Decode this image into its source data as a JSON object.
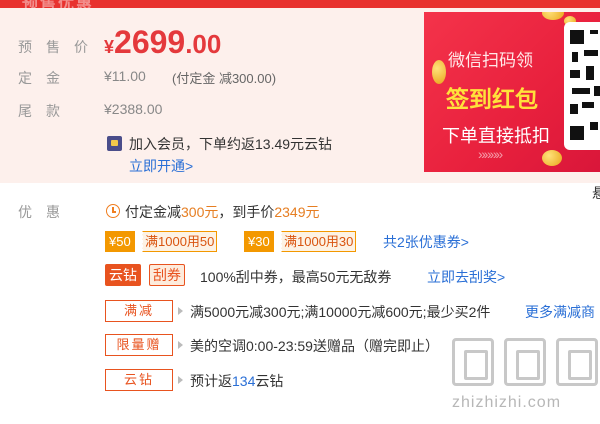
{
  "header_ghost_text": "预售优惠",
  "price": {
    "label": "预售价",
    "currency": "¥",
    "integer": "2699",
    "decimal": ".00",
    "color": "#e4393c"
  },
  "deposit": {
    "label": "定金",
    "value": "¥11.00",
    "note": "(付定金 减300.00)"
  },
  "final_payment": {
    "label": "尾款",
    "value": "¥2388.00"
  },
  "member": {
    "icon": "crown-icon",
    "text": "加入会员，下单约返13.49元云钻",
    "link": "立即开通>"
  },
  "promo_banner": {
    "line1": "微信扫码领",
    "line2": "签到红包",
    "line3": "下单直接抵扣",
    "arrows": "»»»»",
    "icon": "qr-code-icon"
  },
  "edge_char": "悬",
  "promotions": {
    "label": "优惠",
    "deposit_offer": {
      "icon": "clock-icon",
      "p1": "付定金减",
      "amount": "300元",
      "p2": "，到手价",
      "final": "2349元"
    },
    "coupons": [
      {
        "value": "¥50",
        "condition": "满1000用50"
      },
      {
        "value": "¥30",
        "condition": "满1000用30"
      }
    ],
    "coupon_link": "共2张优惠券>",
    "scratch": {
      "tag_a": "云钻",
      "tag_b": "刮券",
      "text": "100%刮中券，最高50元无敌券",
      "link": "立即去刮奖>"
    },
    "full_reduction": {
      "tag": "满减",
      "text": "满5000元减300元;满10000元减600元;最少买2件",
      "link": "更多满减商"
    },
    "gift": {
      "tag": "限量赠",
      "text": "美的空调0:00-23:59送赠品（赠完即止）"
    },
    "cloud_diamond": {
      "tag": "云钻",
      "p1": "预计返",
      "amount": "134",
      "p2": "云钻"
    }
  },
  "watermark": {
    "text": "zhizhizhi.com",
    "icon": "watermark-logo-icon"
  }
}
